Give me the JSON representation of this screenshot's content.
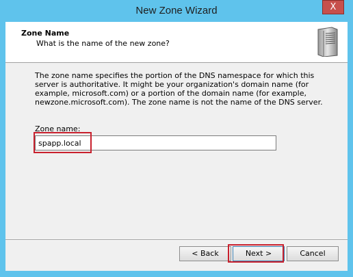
{
  "window": {
    "title": "New Zone Wizard",
    "close_label": "X"
  },
  "header": {
    "title": "Zone Name",
    "subtitle": "What is the name of the new zone?",
    "icon": "server-icon"
  },
  "body": {
    "description": "The zone name specifies the portion of the DNS namespace for which this server is authoritative. It might be your organization's domain name (for example,  microsoft.com) or a portion of the domain name (for example, newzone.microsoft.com). The zone name is not the name of the DNS server.",
    "zone_label": "Zone name:",
    "zone_value": "spapp.local"
  },
  "buttons": {
    "back": "< Back",
    "next": "Next >",
    "cancel": "Cancel"
  },
  "colors": {
    "highlight": "#c8202d",
    "frame": "#5fc3ec",
    "close": "#c7504c"
  }
}
